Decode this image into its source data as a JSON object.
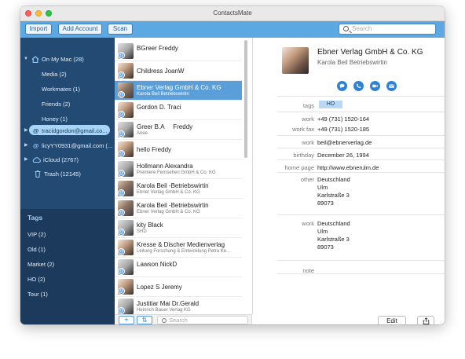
{
  "window": {
    "title": "ContactsMate"
  },
  "toolbar": {
    "import": "Import",
    "add_account": "Add Account",
    "scan": "Scan",
    "search_placeholder": "Search"
  },
  "sidebar": {
    "items": [
      {
        "label": "On My Mac (28)",
        "icon": "house-icon",
        "level": 0,
        "expanded": true
      },
      {
        "label": "Media (2)",
        "level": 1
      },
      {
        "label": "Workmates (1)",
        "level": 1
      },
      {
        "label": "Friends (2)",
        "level": 1
      },
      {
        "label": "Honey (1)",
        "level": 1
      },
      {
        "label": "tracidgordon@gmail.co...",
        "icon": "at-icon",
        "level": 0,
        "selected": true
      },
      {
        "label": "licyYY0931@gmail.com (...",
        "icon": "at-icon",
        "level": 0
      },
      {
        "label": "iCloud (2767)",
        "icon": "cloud-icon",
        "level": 0
      },
      {
        "label": "Trash (12145)",
        "icon": "trash-icon",
        "level": 1
      }
    ],
    "tags_header": "Tags",
    "tags": [
      "VIP (2)",
      "Old (1)",
      "Market (2)",
      "HO (2)",
      "Tour (1)"
    ]
  },
  "contacts": [
    {
      "name": "BGreer Freddy",
      "sub": ""
    },
    {
      "name": "Childress JoanW",
      "sub": ""
    },
    {
      "name": "Ebner Verlag GmbH & Co. KG",
      "sub": "Karola Beil Betriebswirtin",
      "selected": true
    },
    {
      "name": "Gordon D. Traci",
      "sub": ""
    },
    {
      "name": "Greer B.A     Freddy",
      "sub": "Anee"
    },
    {
      "name": "hello Freddy",
      "sub": ""
    },
    {
      "name": "Hollmann Alexandra",
      "sub": "Premiere Fernsehen GmbH & Co. KG"
    },
    {
      "name": "Karola Beil -Betriebswirtin",
      "sub": "Ebner Verlag GmbH & Co. KG"
    },
    {
      "name": "Karola Beil -Betriebswirtin",
      "sub": "Ebner Verlag GmbH & Co. KG"
    },
    {
      "name": "kity Black",
      "sub": "SHD"
    },
    {
      "name": "Kresse & Discher Medienverlag",
      "sub": "Leitung Forschung & Entwicklung Petra Ke..."
    },
    {
      "name": "Lawson NickD",
      "sub": ""
    },
    {
      "name": "Lopez S Jeremy",
      "sub": ""
    },
    {
      "name": "Justitiar Mai Dr.Gerald",
      "sub": "Heinrich Bauer Verlag KG"
    }
  ],
  "list_footer": {
    "add": "+",
    "sort": "⇅",
    "search_placeholder": "Search"
  },
  "detail": {
    "name": "Ebner Verlag GmbH & Co. KG",
    "subtitle": "Karola Beil Betriebswirtin",
    "actions": [
      "message-icon",
      "phone-icon",
      "video-icon",
      "email-icon"
    ],
    "fields": {
      "tags_label": "tags",
      "tags_value": "HO",
      "work_label": "work",
      "work_value": "+49 (731) 1520-164",
      "workfax_label": "work fax",
      "workfax_value": "+49 (731) 1520-185",
      "email_label": "work",
      "email_value": "beil@ebnerverlag.de",
      "birthday_label": "birthday",
      "birthday_value": "December 26, 1994",
      "homepage_label": "home page",
      "homepage_value": "http://www.ebnerulm.de",
      "other_label": "other",
      "other_lines": [
        "Deutschland",
        "Ulm",
        "Karlstraße 3",
        "89073"
      ],
      "addr_work_label": "work",
      "work_lines": [
        "Deutschland",
        "Ulm",
        "Karlstraße 3",
        "89073"
      ],
      "note_label": "note"
    },
    "edit": "Edit",
    "share": "share-icon"
  },
  "colors": {
    "toolbar": "#5ca8e3",
    "sidebar": "#234a73",
    "selection": "#5a9fd9",
    "accent": "#2e82d6"
  }
}
